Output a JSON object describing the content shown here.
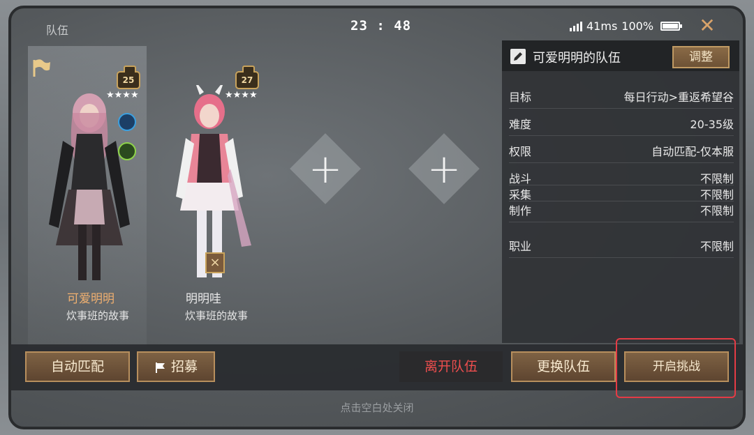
{
  "header": {
    "title": "队伍",
    "clock": "23 : 48",
    "ping": "41ms",
    "battery": "100%"
  },
  "members": [
    {
      "level": "25",
      "stars": "★★★★",
      "name": "可爱明明",
      "guild": "炊事班的故事",
      "name_color": "#f0b070"
    },
    {
      "level": "27",
      "stars": "★★★★",
      "name": "明明哇",
      "guild": "炊事班的故事",
      "name_color": "#ffffff"
    }
  ],
  "kick_label": "×",
  "add_plus": "+",
  "team": {
    "name": "可爱明明的队伍",
    "adjust_label": "调整",
    "rows": [
      {
        "key": "目标",
        "value": "每日行动>重返希望谷"
      },
      {
        "key": "难度",
        "value": "20-35级"
      },
      {
        "key": "权限",
        "value": "自动匹配-仅本服"
      },
      {
        "key": "战斗",
        "value": "不限制"
      },
      {
        "key": "采集",
        "value": "不限制"
      },
      {
        "key": "制作",
        "value": "不限制"
      },
      {
        "key": "职业",
        "value": "不限制"
      }
    ]
  },
  "buttons": {
    "auto_match": "自动匹配",
    "recruit": "招募",
    "leave": "离开队伍",
    "change": "更换队伍",
    "start": "开启挑战"
  },
  "hint": "点击空白处关闭",
  "colors": {
    "accent_gold": "#c9a35c",
    "leave_red": "#ee4e4e",
    "highlight": "#e53b45"
  }
}
